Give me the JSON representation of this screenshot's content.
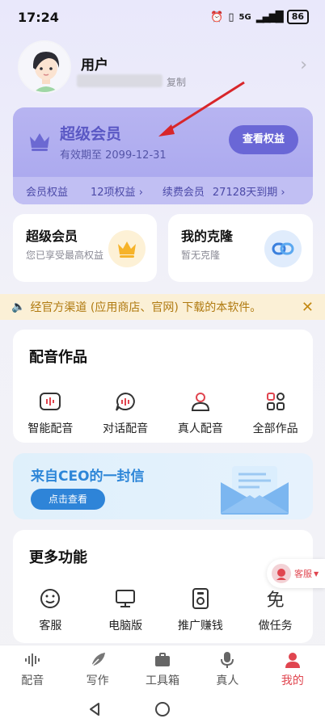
{
  "status": {
    "time": "17:24",
    "network": "5G",
    "battery": "86"
  },
  "profile": {
    "name": "用户",
    "copy_label": "复制"
  },
  "vip": {
    "title": "超级会员",
    "expire": "有效期至 2099-12-31",
    "button": "查看权益",
    "benefits_label": "会员权益",
    "benefits_count": "12项权益 ›",
    "renew_label": "续费会员",
    "days_left": "27128天到期 ›"
  },
  "cards": {
    "super_vip": {
      "title": "超级会员",
      "sub": "您已享受最高权益"
    },
    "clone": {
      "title": "我的克隆",
      "sub": "暂无克隆"
    }
  },
  "notice": {
    "text": "经官方渠道 (应用商店、官网) 下载的本软件。"
  },
  "dubbing": {
    "title": "配音作品",
    "items": [
      {
        "label": "智能配音",
        "icon": "waveform-icon"
      },
      {
        "label": "对话配音",
        "icon": "chat-wave-icon"
      },
      {
        "label": "真人配音",
        "icon": "person-icon"
      },
      {
        "label": "全部作品",
        "icon": "grid-icon"
      }
    ]
  },
  "ceo": {
    "title": "来自CEO的一封信",
    "button": "点击查看"
  },
  "more": {
    "title": "更多功能",
    "items": [
      {
        "label": "客服",
        "icon": "smile-icon"
      },
      {
        "label": "电脑版",
        "icon": "monitor-icon"
      },
      {
        "label": "推广赚钱",
        "icon": "promo-icon"
      },
      {
        "label": "做任务",
        "icon": "task-icon"
      }
    ]
  },
  "service_float": {
    "label": "客服"
  },
  "nav": {
    "items": [
      {
        "label": "配音",
        "icon": "waveform-icon",
        "active": false
      },
      {
        "label": "写作",
        "icon": "feather-icon",
        "active": false
      },
      {
        "label": "工具箱",
        "icon": "toolbox-icon",
        "active": false
      },
      {
        "label": "真人",
        "icon": "mic-icon",
        "active": false
      },
      {
        "label": "我的",
        "icon": "user-icon",
        "active": true
      }
    ]
  },
  "colors": {
    "accent": "#e0454f",
    "vip_purple": "#6a67d6",
    "ceo_blue": "#2e84d8"
  }
}
